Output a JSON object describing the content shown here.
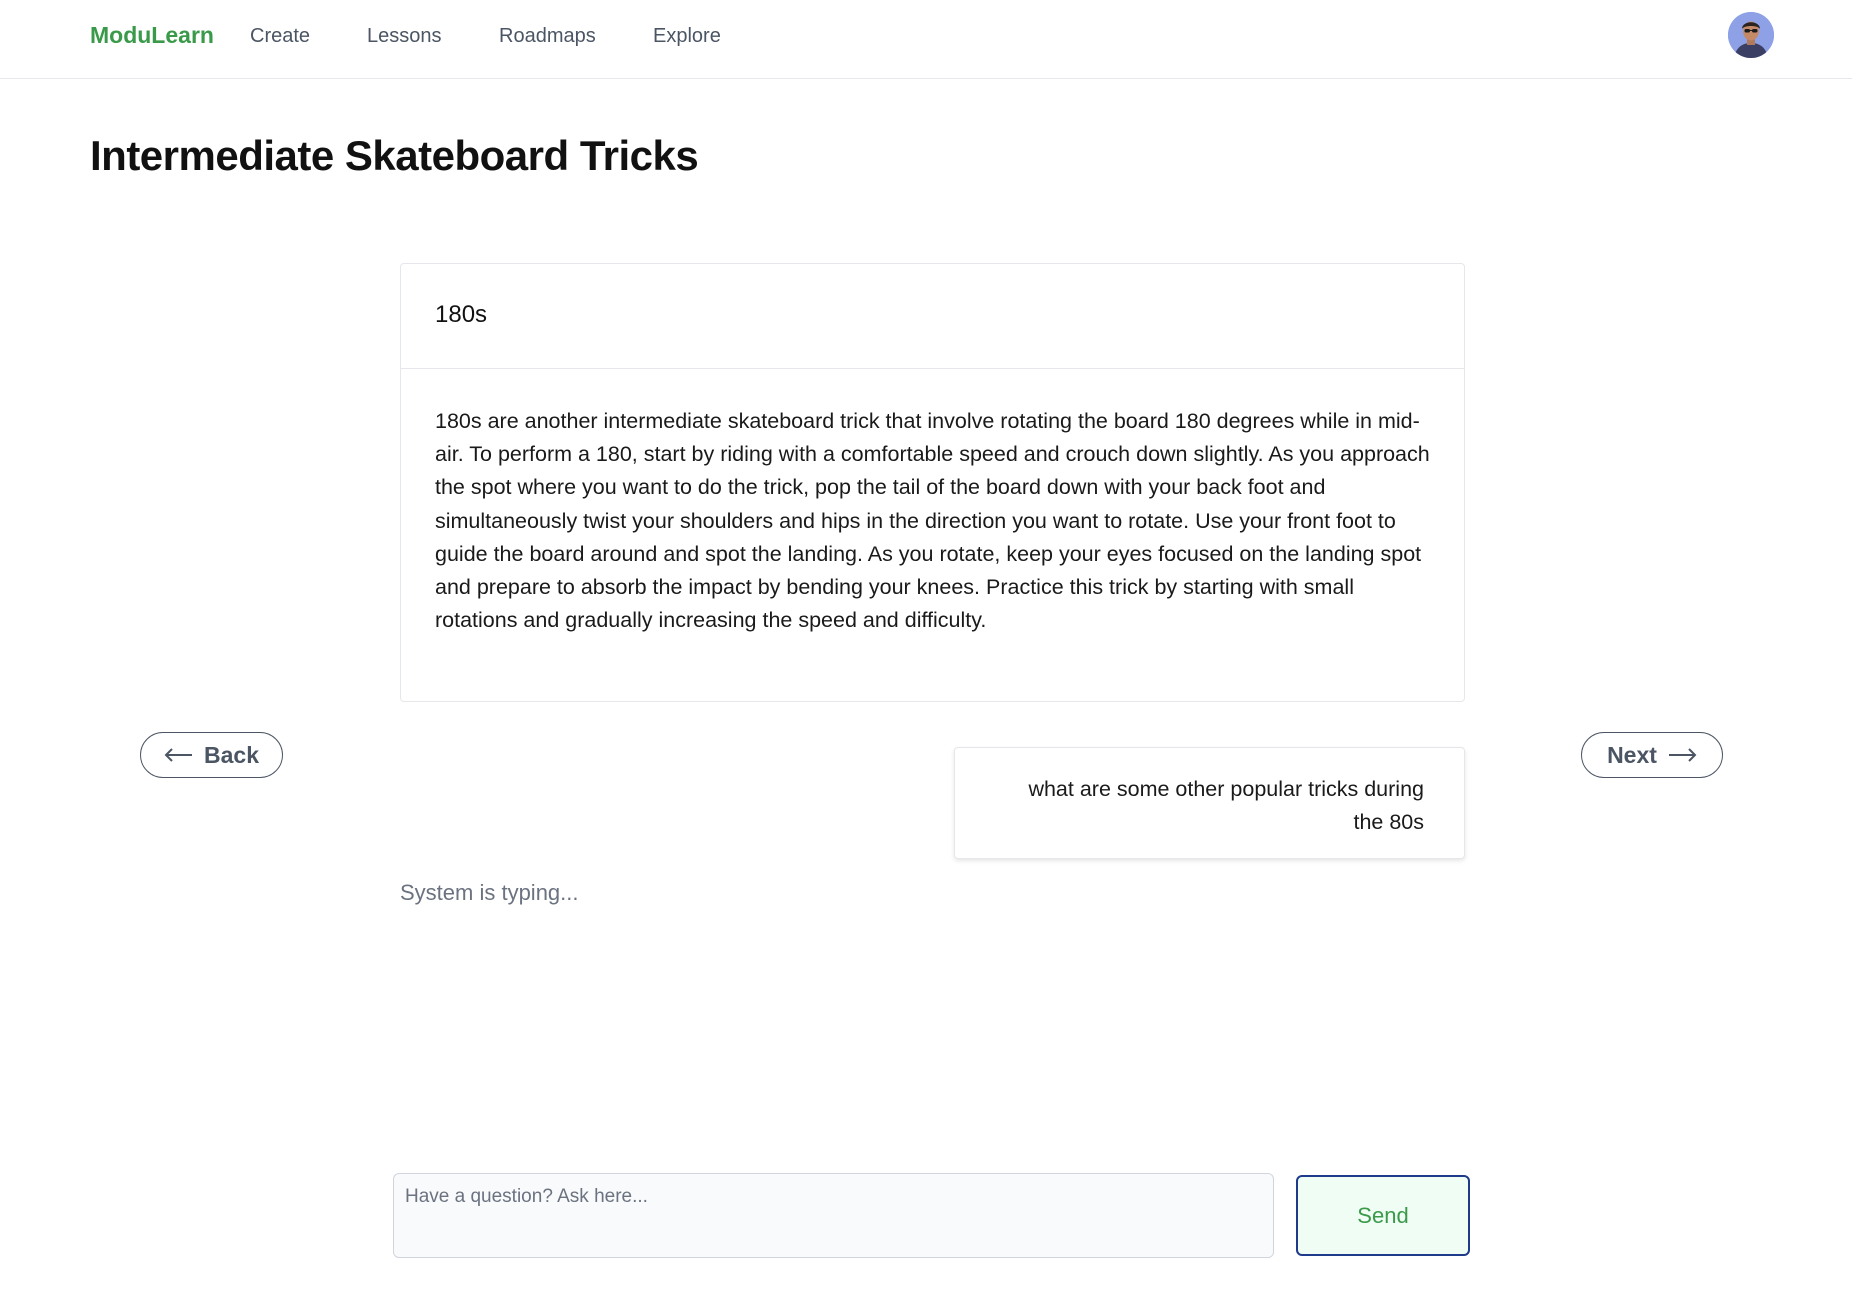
{
  "nav": {
    "brand": "ModuLearn",
    "links": [
      {
        "label": "Create"
      },
      {
        "label": "Lessons"
      },
      {
        "label": "Roadmaps"
      },
      {
        "label": "Explore"
      }
    ],
    "avatar_icon": "user-avatar"
  },
  "page": {
    "title": "Intermediate Skateboard Tricks"
  },
  "lesson": {
    "heading": "180s",
    "body": "180s are another intermediate skateboard trick that involve rotating the board 180 degrees while in mid-air. To perform a 180, start by riding with a comfortable speed and crouch down slightly. As you approach the spot where you want to do the trick, pop the tail of the board down with your back foot and simultaneously twist your shoulders and hips in the direction you want to rotate. Use your front foot to guide the board around and spot the landing. As you rotate, keep your eyes focused on the landing spot and prepare to absorb the impact by bending your knees. Practice this trick by starting with small rotations and gradually increasing the speed and difficulty."
  },
  "pager": {
    "back_label": "Back",
    "back_icon": "arrow-left-icon",
    "next_label": "Next",
    "next_icon": "arrow-right-icon"
  },
  "chat": {
    "user_message": "what are some other popular tricks during the 80s",
    "status": "System is typing...",
    "input_value": "",
    "input_placeholder": "Have a question? Ask here...",
    "send_label": "Send"
  },
  "colors": {
    "brand": "#3a9a4a",
    "send_border": "#1e3a8a",
    "send_background": "#f0fdf4"
  }
}
